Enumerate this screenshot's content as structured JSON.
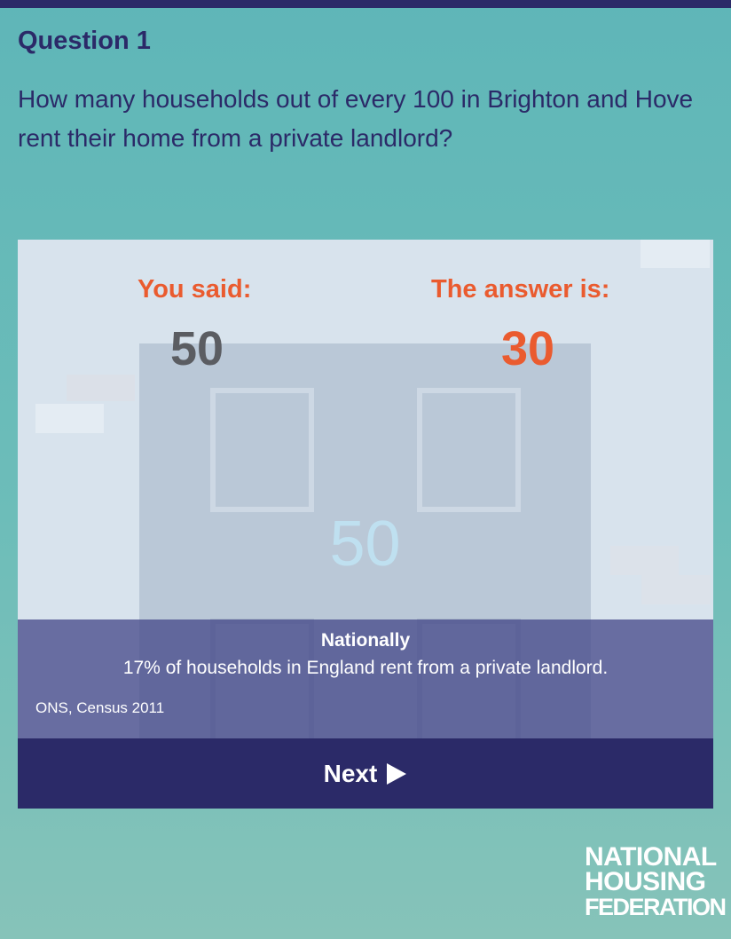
{
  "quiz": {
    "question_number": "Question 1",
    "question_text": "How many households out of every 100 in Brighton and Hove rent their home from a private landlord?"
  },
  "result": {
    "you_said_label": "You said:",
    "you_said_value": "50",
    "answer_label": "The answer is:",
    "answer_value": "30",
    "door_number": "50"
  },
  "info": {
    "title": "Nationally",
    "text": "17% of households in England rent from a private landlord.",
    "source": "ONS, Census 2011"
  },
  "next_button": {
    "label": "Next",
    "icon": "play-icon"
  },
  "logo": {
    "lines": [
      "NATIONAL",
      "HOUSING",
      "FEDERATION"
    ]
  },
  "colors": {
    "background": "#5fb6b8",
    "brand_navy": "#2b2a68",
    "accent_orange": "#ea5b2f",
    "card_background": "#d8e3ed"
  }
}
